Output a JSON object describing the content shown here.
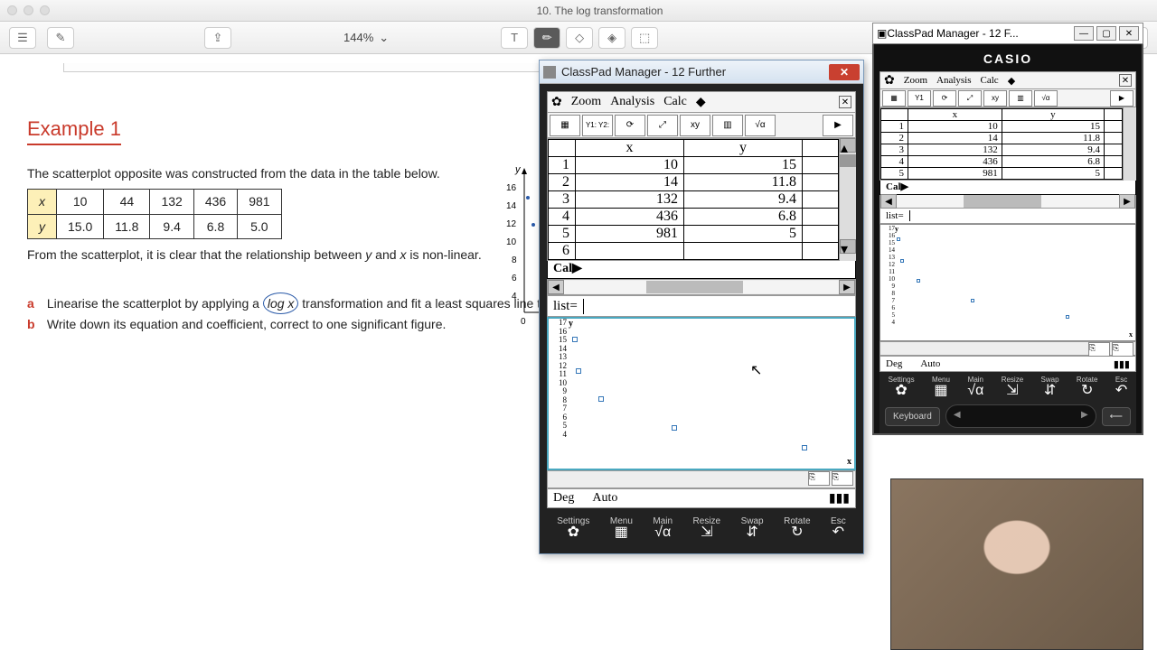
{
  "mac": {
    "title": "10. The log transformation",
    "zoom": "144%"
  },
  "document": {
    "example_label": "Example 1",
    "intro": "The scatterplot opposite was constructed from the data in the table below.",
    "table": {
      "x_label": "x",
      "y_label": "y",
      "x": [
        "10",
        "44",
        "132",
        "436",
        "981"
      ],
      "y": [
        "15.0",
        "11.8",
        "9.4",
        "6.8",
        "5.0"
      ]
    },
    "after_table_1": "From the scatterplot, it is clear that the relationship between ",
    "after_table_y": "y",
    "after_table_and": " and ",
    "after_table_x": "x",
    "after_table_2": " is non-linear.",
    "task_a_label": "a",
    "task_a_1": "Linearise the scatterplot by applying a ",
    "task_a_log": "log x",
    "task_a_2": " transformation and fit a least squares line to",
    "task_b_label": "b",
    "task_b": "Write down its equation and coefficient, correct to one significant figure.",
    "sketch_y": "y",
    "sketch_ticks": [
      "16",
      "14",
      "12",
      "10",
      "8",
      "6",
      "4"
    ],
    "sketch_zero": "0"
  },
  "classpad_large": {
    "window_title": "ClassPad Manager - 12 Further",
    "menu": {
      "zoom": "Zoom",
      "analysis": "Analysis",
      "calc": "Calc"
    },
    "icons": [
      "▦",
      "Y1:\nY2:",
      "⟳",
      "⤢",
      "xy",
      "▥",
      "√α",
      "▶"
    ],
    "sheet": {
      "headers": [
        "",
        "x",
        "y",
        ""
      ],
      "rows": [
        [
          "1",
          "10",
          "15"
        ],
        [
          "2",
          "14",
          "11.8"
        ],
        [
          "3",
          "132",
          "9.4"
        ],
        [
          "4",
          "436",
          "6.8"
        ],
        [
          "5",
          "981",
          "5"
        ],
        [
          "6",
          "",
          ""
        ]
      ]
    },
    "cal": "Cal▶",
    "list_label": "list=",
    "list_value": "",
    "status_deg": "Deg",
    "status_auto": "Auto",
    "bottom": [
      {
        "l": "Settings",
        "i": "✿"
      },
      {
        "l": "Menu",
        "i": "▦"
      },
      {
        "l": "Main",
        "i": "√α"
      },
      {
        "l": "Resize",
        "i": "⇲"
      },
      {
        "l": "Swap",
        "i": "⇵"
      },
      {
        "l": "Rotate",
        "i": "↻"
      },
      {
        "l": "Esc",
        "i": "↶"
      }
    ]
  },
  "classpad_small": {
    "window_title": "ClassPad Manager - 12 F...",
    "brand": "CASIO",
    "menu": {
      "zoom": "Zoom",
      "analysis": "Analysis",
      "calc": "Calc"
    },
    "sheet": {
      "headers": [
        "",
        "x",
        "y",
        ""
      ],
      "rows": [
        [
          "1",
          "10",
          "15"
        ],
        [
          "2",
          "14",
          "11.8"
        ],
        [
          "3",
          "132",
          "9.4"
        ],
        [
          "4",
          "436",
          "6.8"
        ],
        [
          "5",
          "981",
          "5"
        ]
      ]
    },
    "cal": "Cal▶",
    "list_label": "list=",
    "status_deg": "Deg",
    "status_auto": "Auto",
    "keys": {
      "keyboard": "Keyboard",
      "back": "⟵"
    },
    "bottom": [
      {
        "l": "Settings",
        "i": "✿"
      },
      {
        "l": "Menu",
        "i": "▦"
      },
      {
        "l": "Main",
        "i": "√α"
      },
      {
        "l": "Resize",
        "i": "⇲"
      },
      {
        "l": "Swap",
        "i": "⇵"
      },
      {
        "l": "Rotate",
        "i": "↻"
      },
      {
        "l": "Esc",
        "i": "↶"
      }
    ]
  },
  "chart_data": {
    "type": "scatter",
    "title": "",
    "xlabel": "x",
    "ylabel": "y",
    "x": [
      10,
      44,
      132,
      436,
      981
    ],
    "y": [
      15.0,
      11.8,
      9.4,
      6.8,
      5.0
    ],
    "xlim": [
      0,
      1000
    ],
    "ylim": [
      3,
      17
    ],
    "y_ticks": [
      4,
      5,
      6,
      7,
      8,
      9,
      10,
      11,
      12,
      13,
      14,
      15,
      16,
      17
    ]
  }
}
